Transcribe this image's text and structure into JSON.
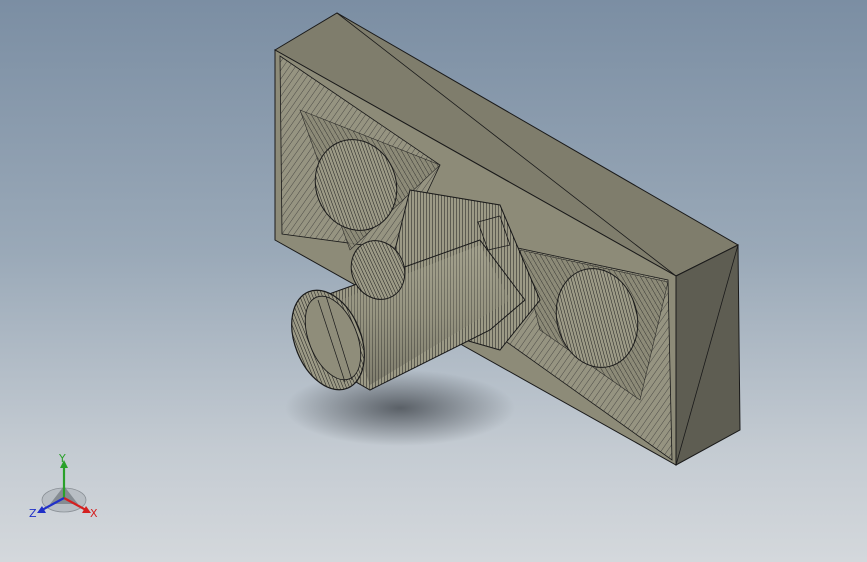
{
  "viewport": {
    "background_top": "#7b8ea3",
    "background_bottom": "#d4d8dc",
    "model": {
      "face_front": "#8d8b78",
      "face_top": "#7f7d6c",
      "face_side": "#5d5c51",
      "edge_color": "#1a1a1a"
    }
  },
  "triad": {
    "x_label": "X",
    "y_label": "Y",
    "z_label": "Z",
    "x_color": "#d42020",
    "y_color": "#2aa12a",
    "z_color": "#2030c8"
  }
}
